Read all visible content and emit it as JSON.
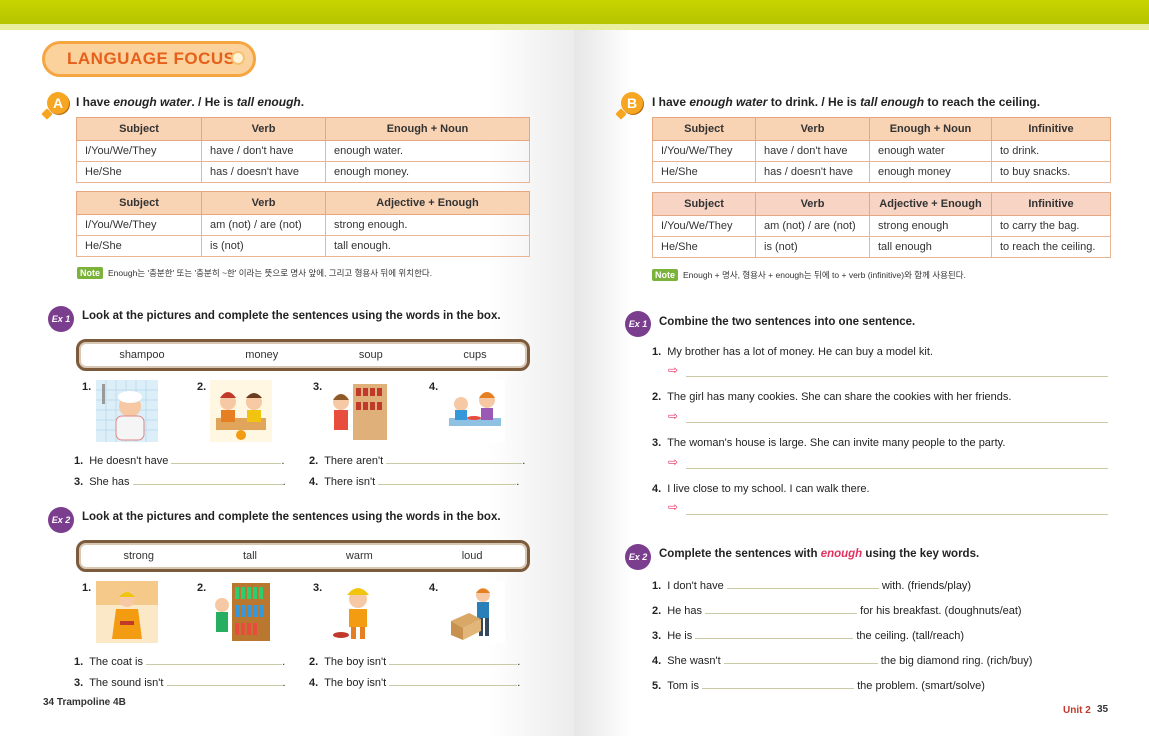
{
  "header": {
    "language_focus": "LANGUAGE FOCUS"
  },
  "left": {
    "sectionA": {
      "badge": "A",
      "title_parts": [
        "I have ",
        "enough water",
        ". / He is ",
        "tall enough",
        "."
      ],
      "table1": {
        "headers": [
          "Subject",
          "Verb",
          "Enough + Noun"
        ],
        "rows": [
          [
            "I/You/We/They",
            "have / don't have",
            "enough water."
          ],
          [
            "He/She",
            "has / doesn't have",
            "enough money."
          ]
        ]
      },
      "table2": {
        "headers": [
          "Subject",
          "Verb",
          "Adjective + Enough"
        ],
        "rows": [
          [
            "I/You/We/They",
            "am (not) / are (not)",
            "strong enough."
          ],
          [
            "He/She",
            "is (not)",
            "tall enough."
          ]
        ]
      },
      "note_label": "Note",
      "note_text": "Enough는 '충분한' 또는 '충분히 ~한' 이라는 뜻으로 명사 앞에, 그리고 형용사 뒤에 위치한다."
    },
    "ex1": {
      "badge": "Ex 1",
      "title": "Look at the pictures and complete the sentences using the words in the box.",
      "words": [
        "shampoo",
        "money",
        "soup",
        "cups"
      ],
      "pictures": [
        "1.",
        "2.",
        "3.",
        "4."
      ],
      "sentences": [
        {
          "num": "1.",
          "text": "He doesn't have"
        },
        {
          "num": "2.",
          "text": "There aren't"
        },
        {
          "num": "3.",
          "text": "She has"
        },
        {
          "num": "4.",
          "text": "There isn't"
        }
      ]
    },
    "ex2": {
      "badge": "Ex 2",
      "title": "Look at the pictures and complete the sentences using the words in the box.",
      "words": [
        "strong",
        "tall",
        "warm",
        "loud"
      ],
      "pictures": [
        "1.",
        "2.",
        "3.",
        "4."
      ],
      "sentences": [
        {
          "num": "1.",
          "text": "The coat is"
        },
        {
          "num": "2.",
          "text": "The boy isn't"
        },
        {
          "num": "3.",
          "text": "The sound isn't"
        },
        {
          "num": "4.",
          "text": "The boy isn't"
        }
      ]
    },
    "footer": "34  Trampoline 4B"
  },
  "right": {
    "sectionB": {
      "badge": "B",
      "title_parts": [
        "I have ",
        "enough water",
        " to drink. / He is ",
        "tall enough",
        " to reach the ceiling."
      ],
      "table1": {
        "headers": [
          "Subject",
          "Verb",
          "Enough + Noun",
          "Infinitive"
        ],
        "rows": [
          [
            "I/You/We/They",
            "have / don't have",
            "enough water",
            "to drink."
          ],
          [
            "He/She",
            "has / doesn't have",
            "enough money",
            "to buy snacks."
          ]
        ]
      },
      "table2": {
        "headers": [
          "Subject",
          "Verb",
          "Adjective + Enough",
          "Infinitive"
        ],
        "rows": [
          [
            "I/You/We/They",
            "am (not) / are (not)",
            "strong enough",
            "to carry the bag."
          ],
          [
            "He/She",
            "is (not)",
            "tall enough",
            "to reach the ceiling."
          ]
        ]
      },
      "note_label": "Note",
      "note_text": "Enough + 명사, 형용사 + enough는 뒤에 to + verb (infinitive)와 함께 사용된다."
    },
    "ex1": {
      "badge": "Ex 1",
      "title": "Combine the two sentences into one sentence.",
      "items": [
        {
          "num": "1.",
          "text": "My brother has a lot of money. He can buy a model kit."
        },
        {
          "num": "2.",
          "text": "The girl has many cookies. She can share the cookies with her friends."
        },
        {
          "num": "3.",
          "text": "The woman's house is large. She can invite many people to the party."
        },
        {
          "num": "4.",
          "text": "I live close to my school. I can walk there."
        }
      ],
      "arrow": "⇨"
    },
    "ex2": {
      "badge": "Ex 2",
      "title_before": "Complete the sentences with ",
      "title_key": "enough",
      "title_after": " using the key words.",
      "items": [
        {
          "num": "1.",
          "before": "I don't have",
          "after": "with. (friends/play)"
        },
        {
          "num": "2.",
          "before": "He has",
          "after": "for his breakfast. (doughnuts/eat)"
        },
        {
          "num": "3.",
          "before": "He is",
          "after": "the ceiling. (tall/reach)"
        },
        {
          "num": "4.",
          "before": "She wasn't",
          "after": "the big diamond ring. (rich/buy)"
        },
        {
          "num": "5.",
          "before": "Tom is",
          "after": "the problem. (smart/solve)"
        }
      ]
    },
    "footer_unit": "Unit 2",
    "footer_page": "35"
  }
}
